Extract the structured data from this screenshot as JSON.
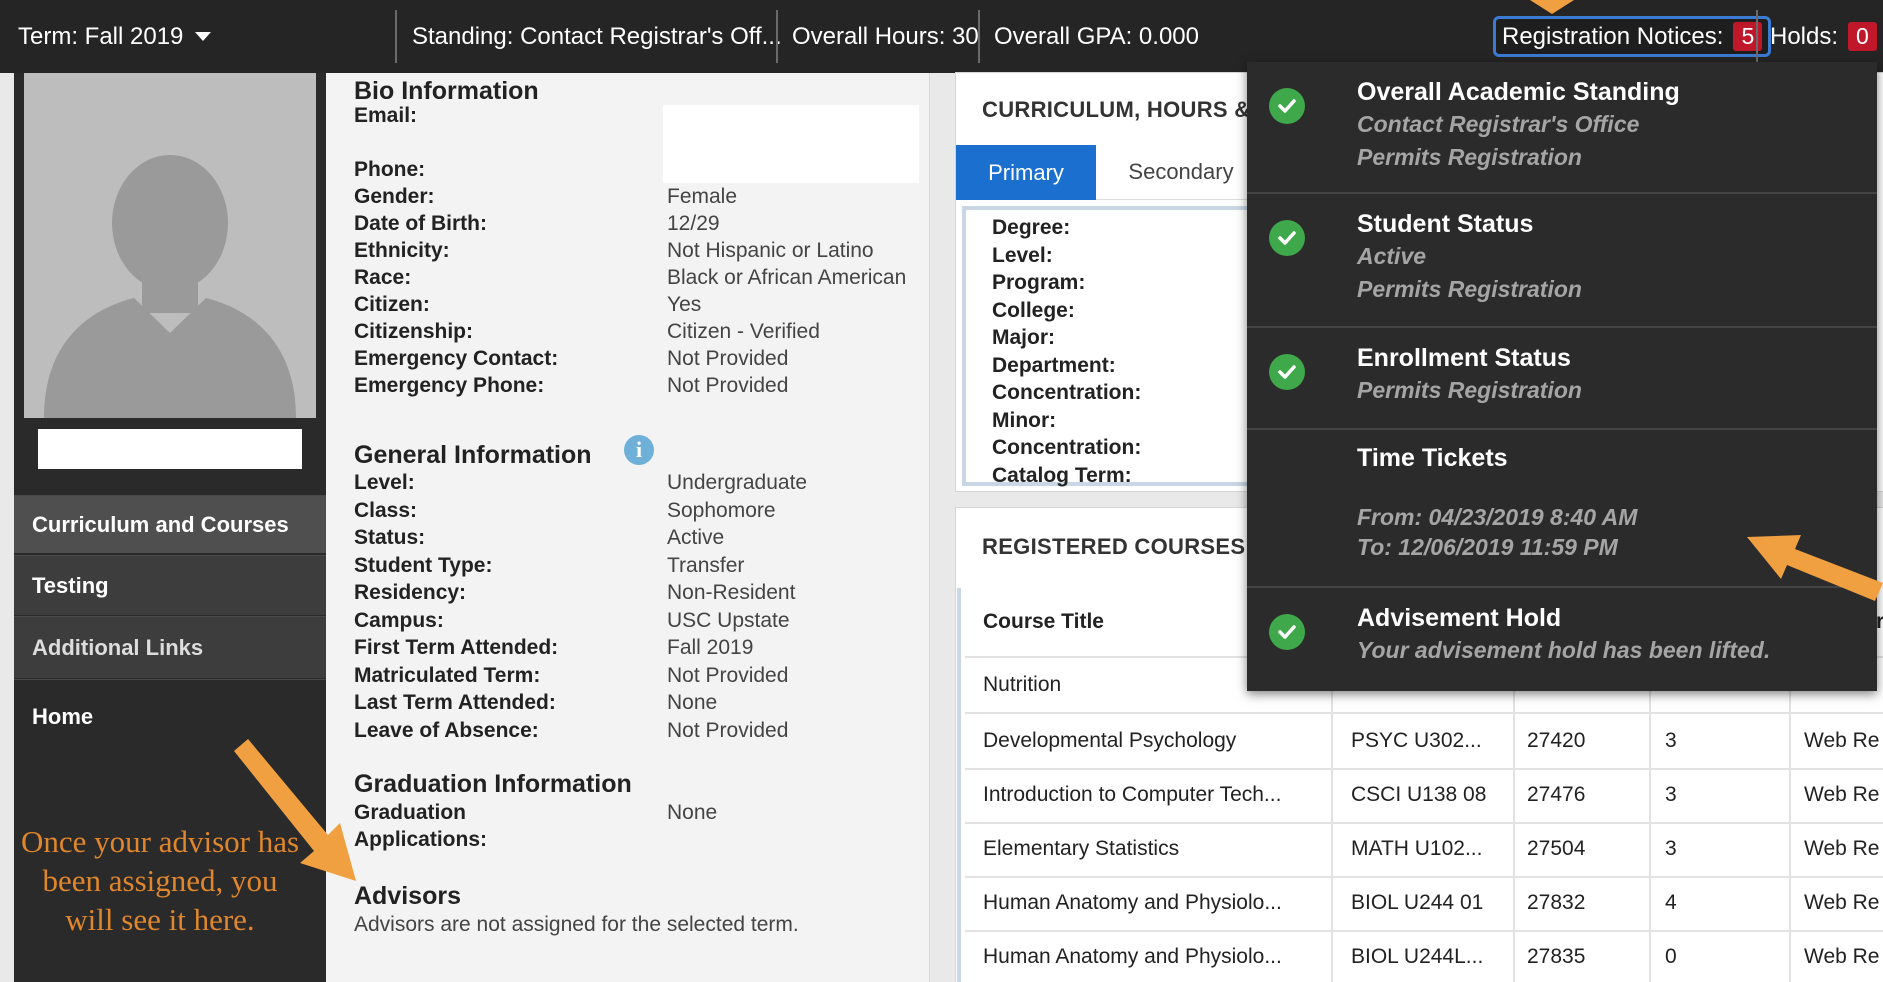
{
  "topbar": {
    "term_label": "Term: Fall 2019",
    "standing": "Standing: Contact Registrar's Off...",
    "hours": "Overall Hours: 30",
    "gpa": "Overall GPA: 0.000",
    "reg_notices_label": "Registration Notices:",
    "reg_notices_count": "5",
    "holds_label": "Holds:",
    "holds_count": "0"
  },
  "sidebar": {
    "items": [
      {
        "label": "Curriculum and Courses"
      },
      {
        "label": "Testing"
      },
      {
        "label": "Additional Links"
      },
      {
        "label": "Home"
      }
    ],
    "annotation": "Once your advisor has been assigned, you will see it here."
  },
  "bio": {
    "title": "Bio Information",
    "fields": [
      {
        "label": "Email:",
        "value": ""
      },
      {
        "label": "Phone:",
        "value": ""
      },
      {
        "label": "Gender:",
        "value": "Female"
      },
      {
        "label": "Date of Birth:",
        "value": "12/29"
      },
      {
        "label": "Ethnicity:",
        "value": "Not Hispanic or Latino"
      },
      {
        "label": "Race:",
        "value": "Black or African American"
      },
      {
        "label": "Citizen:",
        "value": "Yes"
      },
      {
        "label": "Citizenship:",
        "value": "Citizen - Verified"
      },
      {
        "label": "Emergency Contact:",
        "value": "Not Provided"
      },
      {
        "label": "Emergency Phone:",
        "value": "Not Provided"
      }
    ]
  },
  "general": {
    "title": "General Information",
    "fields": [
      {
        "label": "Level:",
        "value": "Undergraduate"
      },
      {
        "label": "Class:",
        "value": "Sophomore"
      },
      {
        "label": "Status:",
        "value": "Active"
      },
      {
        "label": "Student Type:",
        "value": "Transfer"
      },
      {
        "label": "Residency:",
        "value": "Non-Resident"
      },
      {
        "label": "Campus:",
        "value": "USC Upstate"
      },
      {
        "label": "First Term Attended:",
        "value": "Fall 2019"
      },
      {
        "label": "Matriculated Term:",
        "value": "Not Provided"
      },
      {
        "label": "Last Term Attended:",
        "value": "None"
      },
      {
        "label": "Leave of Absence:",
        "value": "Not Provided"
      }
    ]
  },
  "graduation": {
    "title": "Graduation Information",
    "label_line1": "Graduation",
    "label_line2": "Applications:",
    "value": "None"
  },
  "advisors": {
    "title": "Advisors",
    "text": "Advisors are not assigned for the selected term."
  },
  "curriculum": {
    "title": "CURRICULUM, HOURS &",
    "tabs": [
      "Primary",
      "Secondary"
    ],
    "fields": [
      "Degree:",
      "Level:",
      "Program:",
      "College:",
      "Major:",
      "Department:",
      "Concentration:",
      "Minor:",
      "Concentration:",
      "Catalog Term:"
    ]
  },
  "registered": {
    "title": "REGISTERED COURSES",
    "header_course_title": "Course Title",
    "header_last_partial": "r",
    "rows": [
      {
        "title": "Nutrition",
        "subject": "",
        "crn": "",
        "hours": "",
        "status": ""
      },
      {
        "title": "Developmental Psychology",
        "subject": "PSYC U302...",
        "crn": "27420",
        "hours": "3",
        "status": "Web Re"
      },
      {
        "title": "Introduction to Computer Tech...",
        "subject": "CSCI U138 08",
        "crn": "27476",
        "hours": "3",
        "status": "Web Re"
      },
      {
        "title": "Elementary Statistics",
        "subject": "MATH U102...",
        "crn": "27504",
        "hours": "3",
        "status": "Web Re"
      },
      {
        "title": "Human Anatomy and Physiolo...",
        "subject": "BIOL U244 01",
        "crn": "27832",
        "hours": "4",
        "status": "Web Re"
      },
      {
        "title": "Human Anatomy and Physiolo...",
        "subject": "BIOL U244L...",
        "crn": "27835",
        "hours": "0",
        "status": "Web Re"
      }
    ]
  },
  "notices": [
    {
      "title": "Overall Academic Standing",
      "lines": [
        "Contact Registrar's Office",
        "Permits Registration"
      ],
      "check": true
    },
    {
      "title": "Student Status",
      "lines": [
        "Active",
        "Permits Registration"
      ],
      "check": true
    },
    {
      "title": "Enrollment Status",
      "lines": [
        "Permits Registration"
      ],
      "check": true
    },
    {
      "title": "Time Tickets",
      "lines": [
        "From: 04/23/2019 8:40 AM",
        "To: 12/06/2019 11:59 PM"
      ],
      "check": false
    },
    {
      "title": "Advisement Hold",
      "lines": [
        "Your advisement hold has been lifted."
      ],
      "check": true
    }
  ],
  "colors": {
    "accent_blue": "#1a6fcf",
    "badge_red": "#c0182b",
    "check_green": "#3fa84a",
    "annotation_orange": "#f0a040"
  }
}
